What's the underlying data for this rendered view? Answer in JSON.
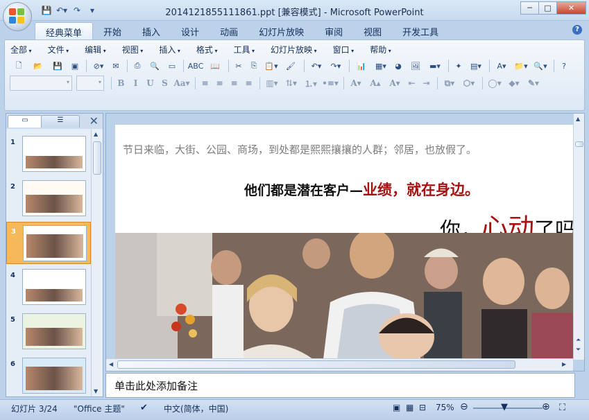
{
  "window": {
    "title": "2014121855111861.ppt [兼容模式] - Microsoft PowerPoint",
    "controls": {
      "minimize": "─",
      "maximize": "□",
      "close": "✕"
    }
  },
  "quick_access": [
    {
      "icon": "save-icon",
      "glyph": "💾"
    },
    {
      "icon": "undo-icon",
      "glyph": "↶▾"
    },
    {
      "icon": "redo-icon",
      "glyph": "↷"
    },
    {
      "icon": "customize-icon",
      "glyph": "▾"
    }
  ],
  "ribbon_tabs": [
    "经典菜单",
    "开始",
    "插入",
    "设计",
    "动画",
    "幻灯片放映",
    "审阅",
    "视图",
    "开发工具"
  ],
  "active_tab": "经典菜单",
  "classic_menus": [
    "全部",
    "文件",
    "编辑",
    "视图",
    "插入",
    "格式",
    "工具",
    "幻灯片放映",
    "窗口",
    "帮助"
  ],
  "toolbar_row1": [
    {
      "icon": "new-icon",
      "glyph": "🗋"
    },
    {
      "icon": "open-icon",
      "glyph": "📂"
    },
    {
      "icon": "save-icon",
      "glyph": "💾"
    },
    {
      "icon": "save-as-pdf-icon",
      "glyph": "▣"
    },
    {
      "icon": "permission-icon",
      "glyph": "⊘▾"
    },
    {
      "icon": "email-icon",
      "glyph": "✉"
    },
    {
      "icon": "print-icon",
      "glyph": "⎙"
    },
    {
      "icon": "print-preview-icon",
      "glyph": "🔍"
    },
    {
      "icon": "layout-icon",
      "glyph": "▭"
    },
    {
      "icon": "spelling-icon",
      "glyph": "ABC"
    },
    {
      "icon": "research-icon",
      "glyph": "📖"
    },
    {
      "icon": "cut-icon",
      "glyph": "✂"
    },
    {
      "icon": "copy-icon",
      "glyph": "⎘"
    },
    {
      "icon": "paste-icon",
      "glyph": "📋▾"
    },
    {
      "icon": "format-painter-icon",
      "glyph": "🖌"
    },
    {
      "icon": "undo-icon",
      "glyph": "↶▾"
    },
    {
      "icon": "redo-icon",
      "glyph": "↷▾"
    },
    {
      "icon": "chart-icon",
      "glyph": "📊"
    },
    {
      "icon": "table-icon",
      "glyph": "▦▾"
    },
    {
      "icon": "clipart-icon",
      "glyph": "◕"
    },
    {
      "icon": "picture-icon",
      "glyph": "🖼"
    },
    {
      "icon": "line-color-icon",
      "glyph": "▬▾"
    },
    {
      "icon": "new-slide-icon",
      "glyph": "✦"
    },
    {
      "icon": "slide-layout-icon",
      "glyph": "▤▾"
    },
    {
      "icon": "textbox-icon",
      "glyph": "A▾"
    },
    {
      "icon": "open-folder-icon",
      "glyph": "📁▾"
    },
    {
      "icon": "zoom-icon",
      "glyph": "🔍▾"
    },
    {
      "icon": "help-icon",
      "glyph": "?"
    }
  ],
  "toolbar_row2": [
    {
      "icon": "bold-icon",
      "glyph": "B"
    },
    {
      "icon": "italic-icon",
      "glyph": "I"
    },
    {
      "icon": "underline-icon",
      "glyph": "U"
    },
    {
      "icon": "strikethrough-icon",
      "glyph": "S"
    },
    {
      "icon": "change-case-icon",
      "glyph": "Aa▾"
    },
    {
      "icon": "align-left-icon",
      "glyph": "≡"
    },
    {
      "icon": "align-center-icon",
      "glyph": "≡"
    },
    {
      "icon": "align-right-icon",
      "glyph": "≡"
    },
    {
      "icon": "justify-icon",
      "glyph": "≡"
    },
    {
      "icon": "columns-icon",
      "glyph": "▥▾"
    },
    {
      "icon": "text-direction-icon",
      "glyph": "⇅▾"
    },
    {
      "icon": "numbering-icon",
      "glyph": "⒈▾"
    },
    {
      "icon": "bullets-icon",
      "glyph": "•≡▾"
    },
    {
      "icon": "font-color-icon",
      "glyph": "A▾"
    },
    {
      "icon": "grow-font-icon",
      "glyph": "A▴"
    },
    {
      "icon": "shrink-font-icon",
      "glyph": "A▾"
    },
    {
      "icon": "decrease-indent-icon",
      "glyph": "⇤"
    },
    {
      "icon": "increase-indent-icon",
      "glyph": "⇥"
    },
    {
      "icon": "arrange-icon",
      "glyph": "⧉▾"
    },
    {
      "icon": "shapes-icon",
      "glyph": "⬡▾"
    },
    {
      "icon": "quick-styles-icon",
      "glyph": "◯▾"
    },
    {
      "icon": "fill-color-icon",
      "glyph": "◆▾"
    },
    {
      "icon": "outline-icon",
      "glyph": "✎▾"
    }
  ],
  "slides_pane": {
    "tabs": [
      {
        "icon": "slides-tab-icon",
        "glyph": "▭"
      },
      {
        "icon": "outline-tab-icon",
        "glyph": "☰"
      }
    ],
    "close": "✕",
    "thumbnails": [
      {
        "number": "1",
        "bg": "#ffffff"
      },
      {
        "number": "2",
        "bg": "#fdfbf4"
      },
      {
        "number": "3",
        "bg": "#ffffff"
      },
      {
        "number": "4",
        "bg": "#ffffff"
      },
      {
        "number": "5",
        "bg": "#eaf4e0"
      },
      {
        "number": "6",
        "bg": "#d8ebf7"
      }
    ],
    "selected": "3"
  },
  "slide": {
    "line1": "节日来临，大街、公园、商场，到处都是熙熙攘攘的人群；邻居，也放假了。",
    "line2_black": "他们都是潜在客户—",
    "line2_red": "业绩，就在身边。",
    "line3_pre": "你，",
    "line3_red": "心动",
    "line3_post": "了吗",
    "colors": {
      "accent": "#a61111",
      "gray": "#7c7c7c"
    }
  },
  "notes": {
    "placeholder": "单击此处添加备注"
  },
  "status": {
    "slide_info": "幻灯片 3/24",
    "theme": "\"Office 主题\"",
    "language": "中文(简体，中国)",
    "zoom": "75%",
    "zoom_level": 0.45
  }
}
